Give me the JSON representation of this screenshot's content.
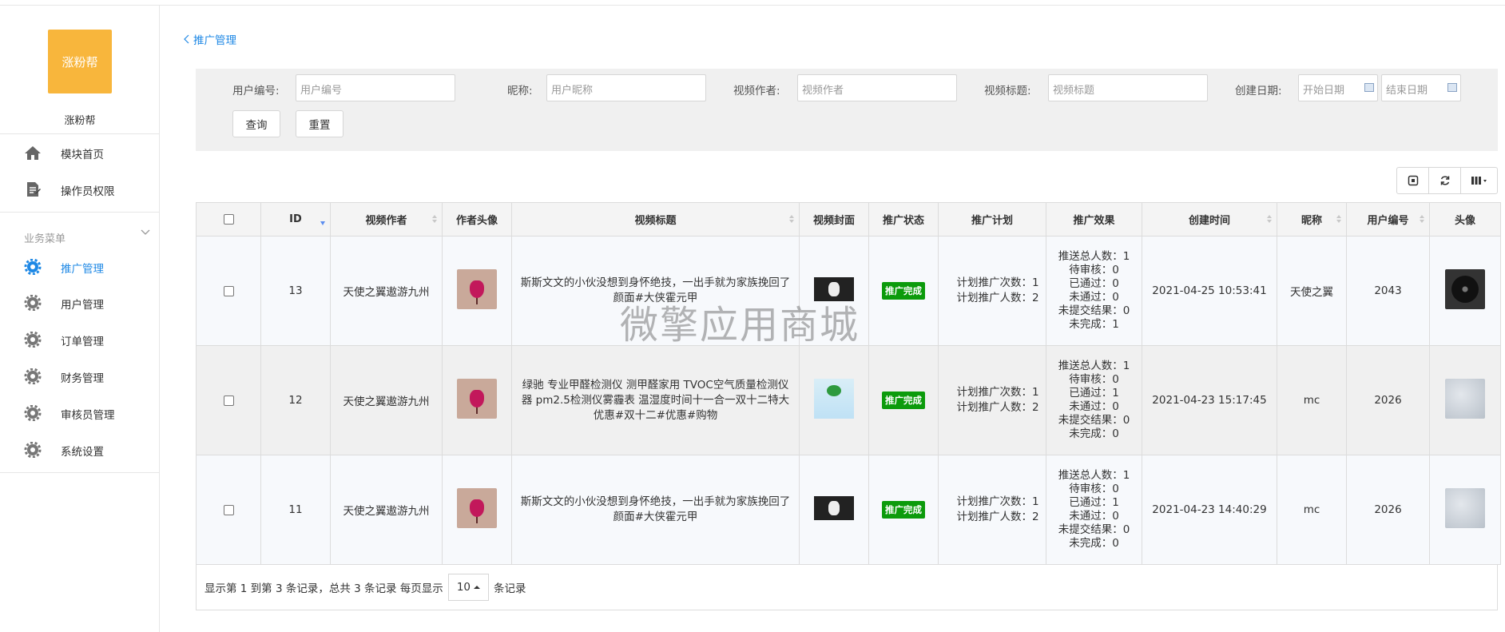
{
  "sidebar": {
    "logo_text": "涨粉帮",
    "brand": "涨粉帮",
    "top_items": [
      {
        "label": "模块首页",
        "icon": "home-icon"
      },
      {
        "label": "操作员权限",
        "icon": "document-icon"
      }
    ],
    "section_label": "业务菜单",
    "biz_items": [
      {
        "label": "推广管理",
        "icon": "gear-icon",
        "active": true
      },
      {
        "label": "用户管理",
        "icon": "gear-icon"
      },
      {
        "label": "订单管理",
        "icon": "gear-icon"
      },
      {
        "label": "财务管理",
        "icon": "gear-icon"
      },
      {
        "label": "审核员管理",
        "icon": "gear-icon"
      },
      {
        "label": "系统设置",
        "icon": "gear-icon"
      }
    ]
  },
  "breadcrumb": {
    "back_label": "推广管理"
  },
  "search": {
    "user_no_label": "用户编号:",
    "user_no_placeholder": "用户编号",
    "nickname_label": "昵称:",
    "nickname_placeholder": "用户昵称",
    "author_label": "视频作者:",
    "author_placeholder": "视频作者",
    "title_label": "视频标题:",
    "title_placeholder": "视频标题",
    "date_label": "创建日期:",
    "start_placeholder": "开始日期",
    "end_placeholder": "结束日期",
    "query_label": "查询",
    "reset_label": "重置"
  },
  "table": {
    "headers": [
      "ID",
      "视频作者",
      "作者头像",
      "视频标题",
      "视频封面",
      "推广状态",
      "推广计划",
      "推广效果",
      "创建时间",
      "昵称",
      "用户编号",
      "头像"
    ],
    "rows": [
      {
        "id": "13",
        "author": "天使之翼遨游九州",
        "title": "斯斯文文的小伙没想到身怀绝技，一出手就为家族挽回了颜面#大侠霍元甲",
        "status": "推广完成",
        "plan": [
          "计划推广次数：1",
          "计划推广人数：2"
        ],
        "effect": [
          "推送总人数：1",
          "待审核：0",
          "已通过：0",
          "未通过：0",
          "未提交结果：0",
          "未完成：1"
        ],
        "created": "2021-04-25 10:53:41",
        "nickname": "天使之翼",
        "user_no": "2043"
      },
      {
        "id": "12",
        "author": "天使之翼遨游九州",
        "title": "绿驰 专业甲醛检测仪 测甲醛家用 TVOC空气质量检测仪器 pm2.5检测仪雾霾表 温湿度时间十一合一双十二特大优惠#双十二#优惠#购物",
        "status": "推广完成",
        "plan": [
          "计划推广次数：1",
          "计划推广人数：2"
        ],
        "effect": [
          "推送总人数：1",
          "待审核：0",
          "已通过：1",
          "未通过：0",
          "未提交结果：0",
          "未完成：0"
        ],
        "created": "2021-04-23 15:17:45",
        "nickname": "mc",
        "user_no": "2026"
      },
      {
        "id": "11",
        "author": "天使之翼遨游九州",
        "title": "斯斯文文的小伙没想到身怀绝技，一出手就为家族挽回了颜面#大侠霍元甲",
        "status": "推广完成",
        "plan": [
          "计划推广次数：1",
          "计划推广人数：2"
        ],
        "effect": [
          "推送总人数：1",
          "待审核：0",
          "已通过：1",
          "未通过：0",
          "未提交结果：0",
          "未完成：0"
        ],
        "created": "2021-04-23 14:40:29",
        "nickname": "mc",
        "user_no": "2026"
      }
    ]
  },
  "footer": {
    "summary": "显示第 1 到第 3 条记录，总共 3 条记录 每页显示",
    "page_size": "10",
    "suffix": "条记录"
  },
  "watermark": "微擎应用商城",
  "colors": {
    "brand": "#f8b63c",
    "accent": "#1e88e5",
    "status_done": "#0c9b0c"
  }
}
